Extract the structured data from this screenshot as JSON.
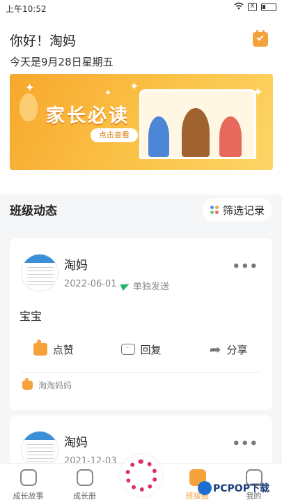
{
  "status": {
    "time": "上午10:52",
    "signal_icon": "wifi-icon",
    "box_label": "X",
    "battery_icon": "battery-icon"
  },
  "header": {
    "greeting": "你好！淘妈",
    "date": "今天是9月28日星期五",
    "calendar_icon": "calendar-check-icon"
  },
  "banner": {
    "title": "家长必读",
    "cta": "点击查看"
  },
  "section": {
    "title": "班级动态",
    "filter_label": "筛选记录"
  },
  "posts": [
    {
      "author": "淘妈",
      "date": "2022-06-01",
      "send_type": "单独发送",
      "content": "宝宝",
      "actions": {
        "like": "点赞",
        "reply": "回复",
        "share": "分享"
      },
      "liker": "淘淘妈妈"
    },
    {
      "author": "淘妈",
      "date": "2021-12-03"
    }
  ],
  "tabbar": {
    "items": [
      "成长故事",
      "成长册",
      "班级圈",
      "我的"
    ],
    "active": "班级圈"
  },
  "watermark": "PCPOP下载",
  "colors": {
    "accent": "#f6a23a",
    "send_green": "#29b16a",
    "center_pink": "#e0306a"
  }
}
